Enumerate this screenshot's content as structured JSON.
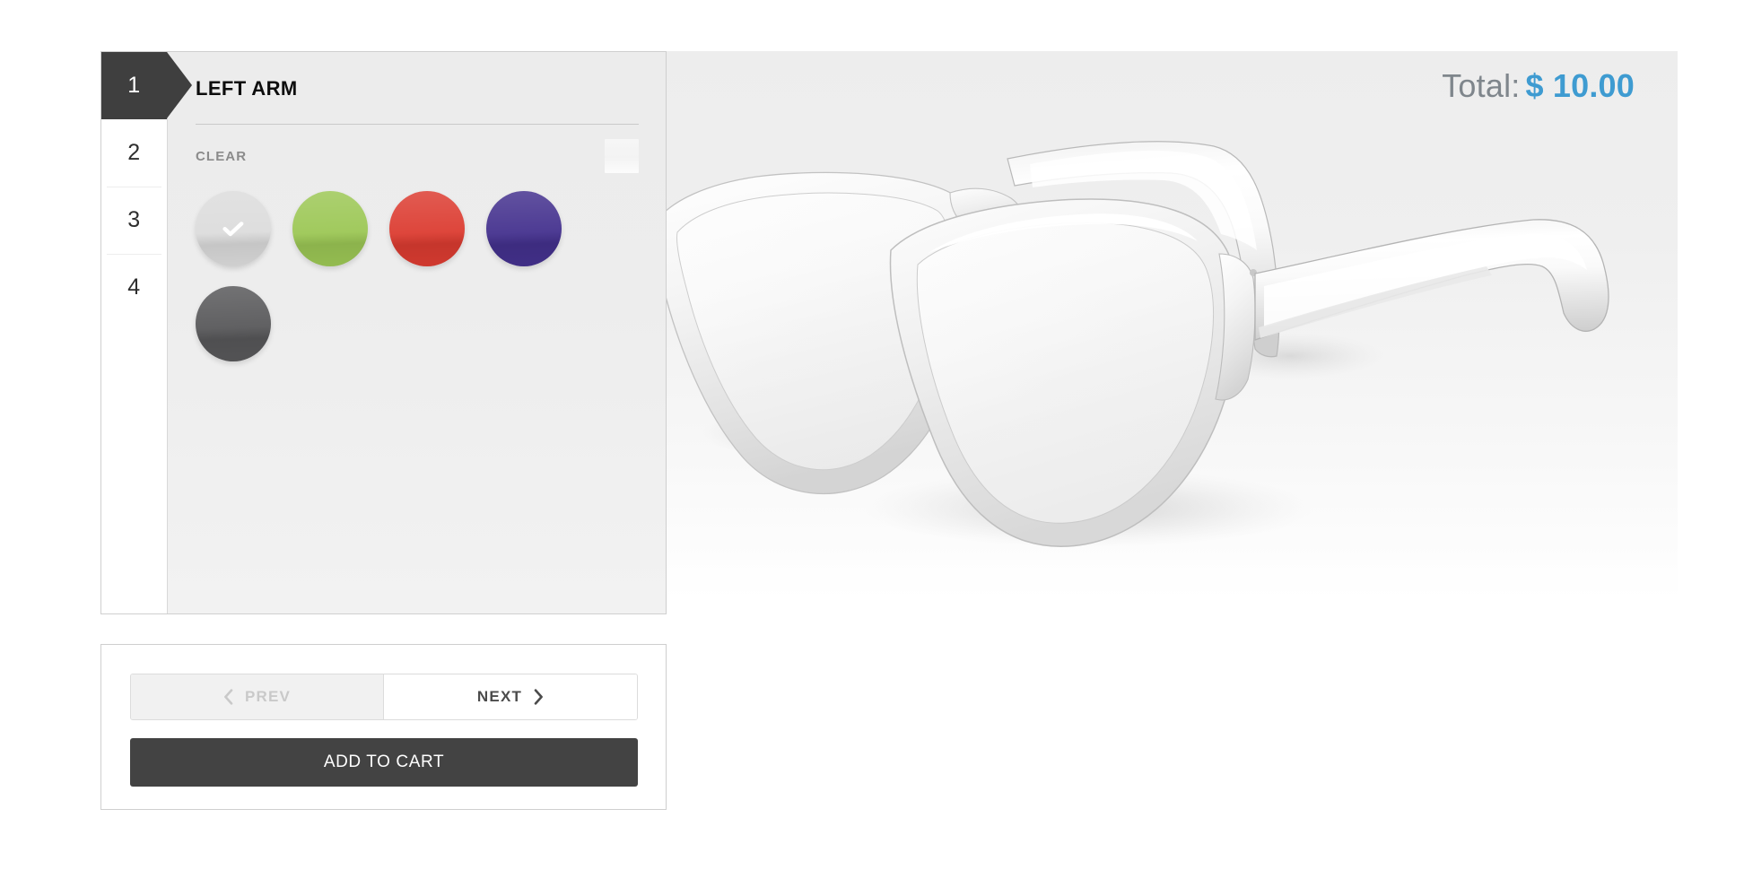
{
  "steps": [
    {
      "number": "1",
      "active": true
    },
    {
      "number": "2",
      "active": false
    },
    {
      "number": "3",
      "active": false
    },
    {
      "number": "4",
      "active": false
    }
  ],
  "configurator": {
    "part_title": "LEFT ARM",
    "option_group_label": "CLEAR",
    "selected_preview_color": "#f6f6f6",
    "swatches": [
      {
        "name": "clear",
        "color": "#dcdcdc",
        "selected": true
      },
      {
        "name": "green",
        "color": "#9cc755",
        "selected": false
      },
      {
        "name": "red",
        "color": "#dc3c31",
        "selected": false
      },
      {
        "name": "purple",
        "color": "#44318e",
        "selected": false
      },
      {
        "name": "dark-grey",
        "color": "#58585a",
        "selected": false
      }
    ]
  },
  "navigation": {
    "prev_label": "PREV",
    "prev_disabled": true,
    "next_label": "NEXT",
    "add_to_cart_label": "ADD TO CART"
  },
  "stage": {
    "total_label": "Total:",
    "total_value": "$ 10.00",
    "product_alt": "eyeglasses-clear-frame"
  },
  "colors": {
    "accent_price": "#3e9bd1",
    "total_label_grey": "#7f868c",
    "active_step_bg": "#3f3f3f",
    "add_to_cart_bg": "#434343",
    "panel_bg": "#ededed"
  }
}
